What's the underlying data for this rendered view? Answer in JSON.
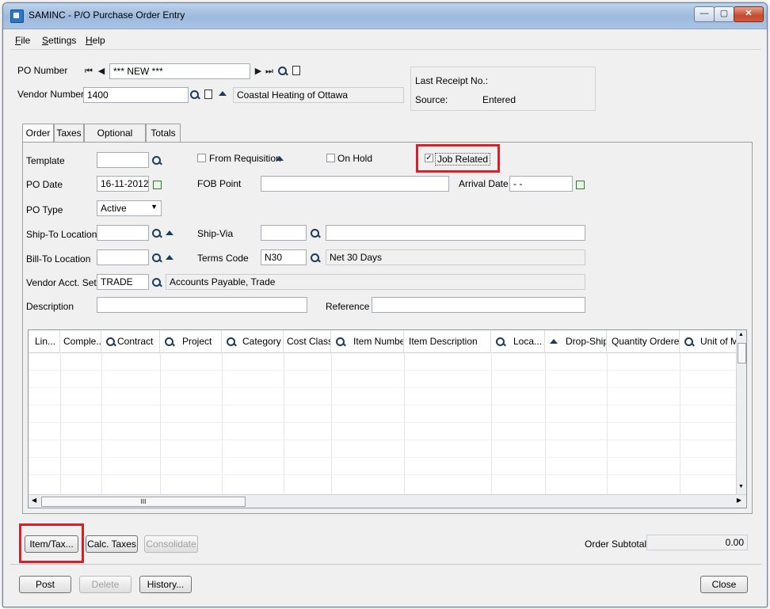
{
  "window": {
    "title": "SAMINC - P/O Purchase Order Entry",
    "minimize": "—",
    "maximize": "▢",
    "close": "✕"
  },
  "menu": [
    "File",
    "Settings",
    "Help"
  ],
  "header": {
    "po_number_label": "PO Number",
    "po_number_value": "*** NEW ***",
    "vendor_number_label": "Vendor Number",
    "vendor_number_value": "1400",
    "vendor_name": "Coastal Heating of Ottawa",
    "last_receipt_label": "Last Receipt No.:",
    "source_label": "Source:",
    "source_value": "Entered"
  },
  "tabs": [
    "Order",
    "Taxes",
    "Optional Fields",
    "Totals"
  ],
  "order": {
    "template_label": "Template",
    "from_requisition_label": "From Requisition",
    "on_hold_label": "On Hold",
    "job_related_label": "Job Related",
    "job_related_checked": "✓",
    "po_date_label": "PO Date",
    "po_date_value": "16-11-2012",
    "fob_point_label": "FOB Point",
    "arrival_date_label": "Arrival Date",
    "arrival_date_value": "- -",
    "po_type_label": "PO Type",
    "po_type_value": "Active",
    "ship_to_label": "Ship-To Location",
    "ship_via_label": "Ship-Via",
    "bill_to_label": "Bill-To Location",
    "terms_code_label": "Terms Code",
    "terms_code_value": "N30",
    "terms_desc": "Net 30 Days",
    "vendor_acct_set_label": "Vendor Acct. Set",
    "vendor_acct_set_value": "TRADE",
    "vendor_acct_set_desc": "Accounts Payable, Trade",
    "description_label": "Description",
    "reference_label": "Reference"
  },
  "grid": {
    "columns": [
      "Lin...",
      "Comple...",
      "Contract",
      "Project",
      "Category",
      "Cost Class",
      "Item Number",
      "Item Description",
      "Loca...",
      "Drop-Ship",
      "Quantity Ordered",
      "Unit of Me"
    ],
    "hscroll_grip": "III"
  },
  "buttons": {
    "item_tax": "Item/Tax...",
    "calc_taxes": "Calc. Taxes",
    "consolidate": "Consolidate",
    "post": "Post",
    "delete": "Delete",
    "history": "History...",
    "close": "Close"
  },
  "totals": {
    "order_subtotal_label": "Order Subtotal",
    "order_subtotal_value": "0.00"
  },
  "colors": {
    "highlight": "#d9202a",
    "titlebar": "#9db9dc"
  }
}
